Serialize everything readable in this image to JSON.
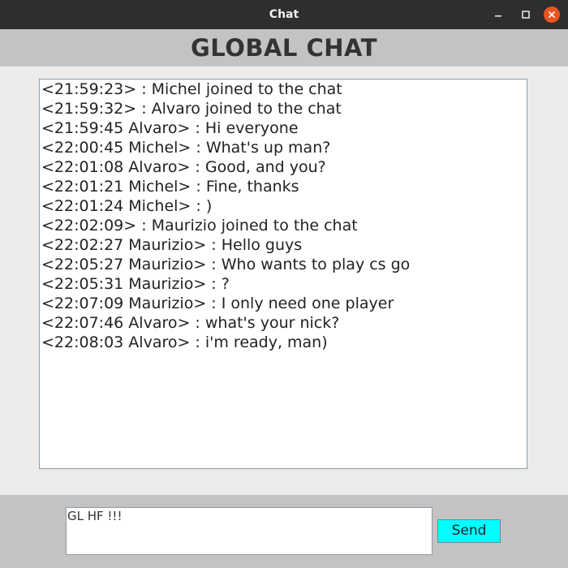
{
  "window": {
    "title": "Chat"
  },
  "header": {
    "title": "GLOBAL CHAT"
  },
  "chat": {
    "messages": [
      "<21:59:23> : Michel joined to the chat",
      "<21:59:32> : Alvaro joined to the chat",
      "<21:59:45 Alvaro> : Hi everyone",
      "<22:00:45 Michel> : What's up man?",
      "<22:01:08 Alvaro> : Good, and you?",
      "<22:01:21 Michel> : Fine, thanks",
      "<22:01:24 Michel> : )",
      "<22:02:09> : Maurizio joined to the chat",
      "<22:02:27 Maurizio> : Hello guys",
      "<22:05:27 Maurizio> : Who wants to play cs go",
      "<22:05:31 Maurizio> : ?",
      "<22:07:09 Maurizio> : I only need one player",
      "<22:07:46 Alvaro> : what's your nick?",
      "<22:08:03 Alvaro> : i'm ready, man)"
    ]
  },
  "composer": {
    "value": "GL HF !!!",
    "send_label": "Send"
  },
  "icons": {
    "minimize": "minimize-icon",
    "maximize": "maximize-icon",
    "close": "close-icon"
  },
  "colors": {
    "titlebar": "#2e2e2e",
    "close_button": "#e95420",
    "header_bg": "#c3c3c3",
    "content_bg": "#ececec",
    "send_button": "#00ffff"
  }
}
